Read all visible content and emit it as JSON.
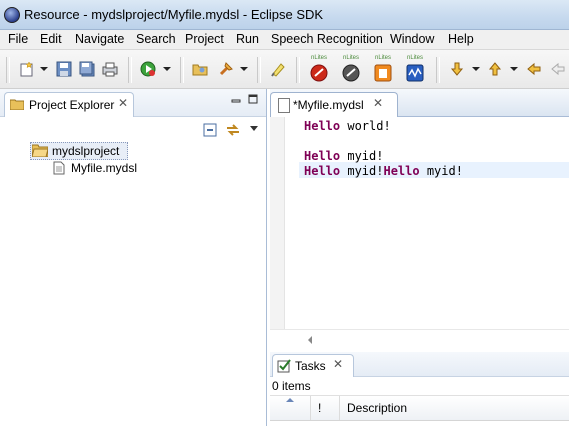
{
  "window": {
    "title": "Resource - mydslproject/Myfile.mydsl - Eclipse SDK"
  },
  "menu": {
    "items": [
      "File",
      "Edit",
      "Navigate",
      "Search",
      "Project",
      "Run",
      "Speech Recognition",
      "Window",
      "Help"
    ]
  },
  "toolbar": {
    "nlites_label": "nLites",
    "icons": [
      "new-wizard-icon",
      "save-icon",
      "save-all-icon",
      "print-icon",
      "run-icon",
      "open-type-icon",
      "search-icon",
      "highlight-icon",
      "nlites-1-icon",
      "nlites-2-icon",
      "nlites-3-icon",
      "nlites-4-icon",
      "next-annotation-icon",
      "previous-annotation-icon",
      "last-edit-icon",
      "back-icon"
    ]
  },
  "project_explorer": {
    "tab_label": "Project Explorer",
    "tree": [
      {
        "label": "mydslproject",
        "type": "project"
      },
      {
        "label": "Myfile.mydsl",
        "type": "file"
      }
    ]
  },
  "editor": {
    "tab_label": "*Myfile.mydsl",
    "lines": [
      {
        "keyword": "Hello",
        "text": " world!"
      },
      {
        "keyword": "",
        "text": ""
      },
      {
        "keyword": "Hello",
        "text": " myid!"
      },
      {
        "keyword": "Hello",
        "text": " myid!",
        "keyword2": "Hello",
        "text2": " myid!"
      }
    ]
  },
  "tasks": {
    "tab_label": "Tasks",
    "item_count": "0 items",
    "columns": [
      "!",
      "Description"
    ]
  },
  "colors": {
    "keyword": "#7f0055",
    "current_line": "#e8f2fe",
    "title_bar": "#c6d9ee"
  }
}
